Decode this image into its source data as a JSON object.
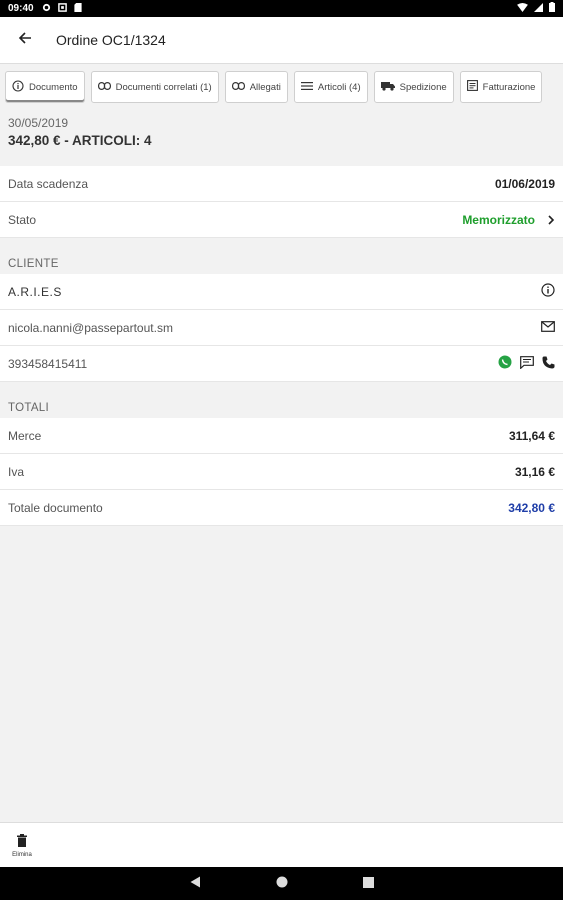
{
  "status_bar": {
    "time": "09:40"
  },
  "app_bar": {
    "title": "Ordine OC1/1324"
  },
  "tabs": [
    {
      "label": "Documento",
      "icon": "info-icon"
    },
    {
      "label": "Documenti correlati (1)",
      "icon": "link-icon"
    },
    {
      "label": "Allegati",
      "icon": "link-icon"
    },
    {
      "label": "Articoli (4)",
      "icon": "list-icon"
    },
    {
      "label": "Spedizione",
      "icon": "truck-icon"
    },
    {
      "label": "Fatturazione",
      "icon": "invoice-icon"
    }
  ],
  "summary": {
    "date": "30/05/2019",
    "total": "342,80 € - ARTICOLI: 4"
  },
  "details": {
    "due_label": "Data scadenza",
    "due_value": "01/06/2019",
    "state_label": "Stato",
    "state_value": "Memorizzato",
    "state_color": "#1e9e2c"
  },
  "cliente": {
    "header": "CLIENTE",
    "name": "A.R.I.E.S",
    "email": "nicola.nanni@passepartout.sm",
    "phone": "393458415411"
  },
  "totali": {
    "header": "TOTALI",
    "merce_label": "Merce",
    "merce_value": "311,64 €",
    "iva_label": "Iva",
    "iva_value": "31,16 €",
    "totale_label": "Totale documento",
    "totale_value": "342,80 €",
    "totale_color": "#1f3ea8"
  },
  "bottom": {
    "delete_label": "Elimina"
  }
}
